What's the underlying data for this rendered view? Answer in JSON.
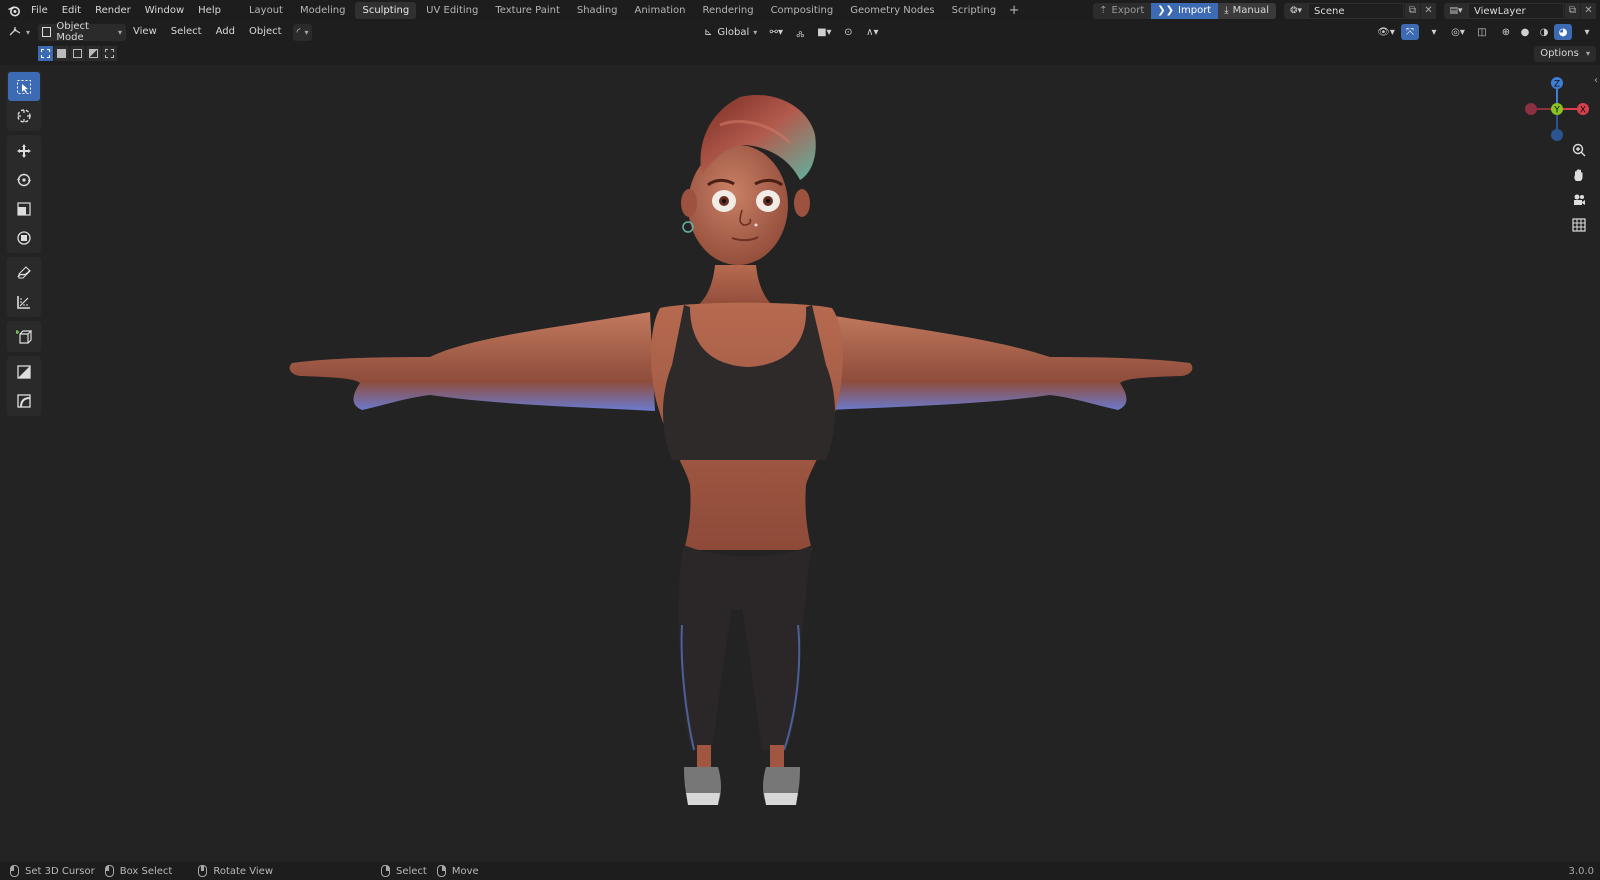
{
  "menus": [
    "File",
    "Edit",
    "Render",
    "Window",
    "Help"
  ],
  "workspaces": [
    "Layout",
    "Modeling",
    "Sculpting",
    "UV Editing",
    "Texture Paint",
    "Shading",
    "Animation",
    "Rendering",
    "Compositing",
    "Geometry Nodes",
    "Scripting"
  ],
  "active_workspace": "Sculpting",
  "add_workspace": "+",
  "io": {
    "export": "Export",
    "import": "Import",
    "manual": "Manual"
  },
  "scene": {
    "name": "Scene"
  },
  "view_layer": {
    "name": "ViewLayer"
  },
  "header": {
    "mode": "Object Mode",
    "view": "View",
    "select": "Select",
    "add": "Add",
    "object": "Object",
    "transform_orientation": "Global"
  },
  "options_label": "Options",
  "gizmo": {
    "x": "X",
    "y": "Y",
    "z": "Z"
  },
  "status": {
    "set_cursor": "Set 3D Cursor",
    "box_select": "Box Select",
    "rotate_view": "Rotate View",
    "select": "Select",
    "move": "Move",
    "version": "3.0.0"
  },
  "colors": {
    "accent": "#3d6bb3",
    "axis_x": "#d8404f",
    "axis_y": "#8ac321",
    "axis_z": "#3d7fd6",
    "viewport_bg": "#232323"
  }
}
